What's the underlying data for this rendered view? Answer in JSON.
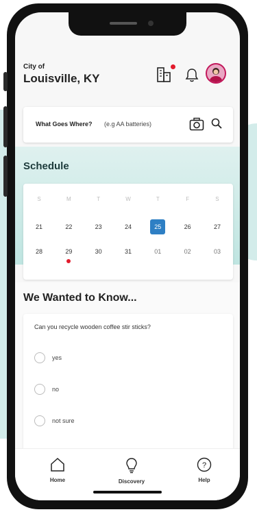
{
  "header": {
    "city_prefix": "City of",
    "city_name": "Louisville, KY"
  },
  "icons": {
    "building": "building-icon",
    "bell": "bell-icon",
    "avatar": "avatar"
  },
  "colors": {
    "accent": "#2e7fc4",
    "alert": "#e21b2c",
    "teal": "#bfe5e1"
  },
  "search": {
    "label": "What Goes Where?",
    "placeholder": "(e.g AA batteries)"
  },
  "schedule": {
    "title": "Schedule",
    "weekdays": [
      "S",
      "M",
      "T",
      "W",
      "T",
      "F",
      "S"
    ],
    "week1": [
      "21",
      "22",
      "23",
      "24",
      "25",
      "26",
      "27"
    ],
    "week2": [
      "28",
      "29",
      "30",
      "31",
      "01",
      "02",
      "03"
    ],
    "selected_day": "25",
    "event_day": "29"
  },
  "poll": {
    "title": "We Wanted to Know...",
    "question": "Can you recycle wooden coffee stir sticks?",
    "options": [
      "yes",
      "no",
      "not sure"
    ]
  },
  "nav": {
    "home": "Home",
    "discovery": "Discovery",
    "help": "Help"
  }
}
